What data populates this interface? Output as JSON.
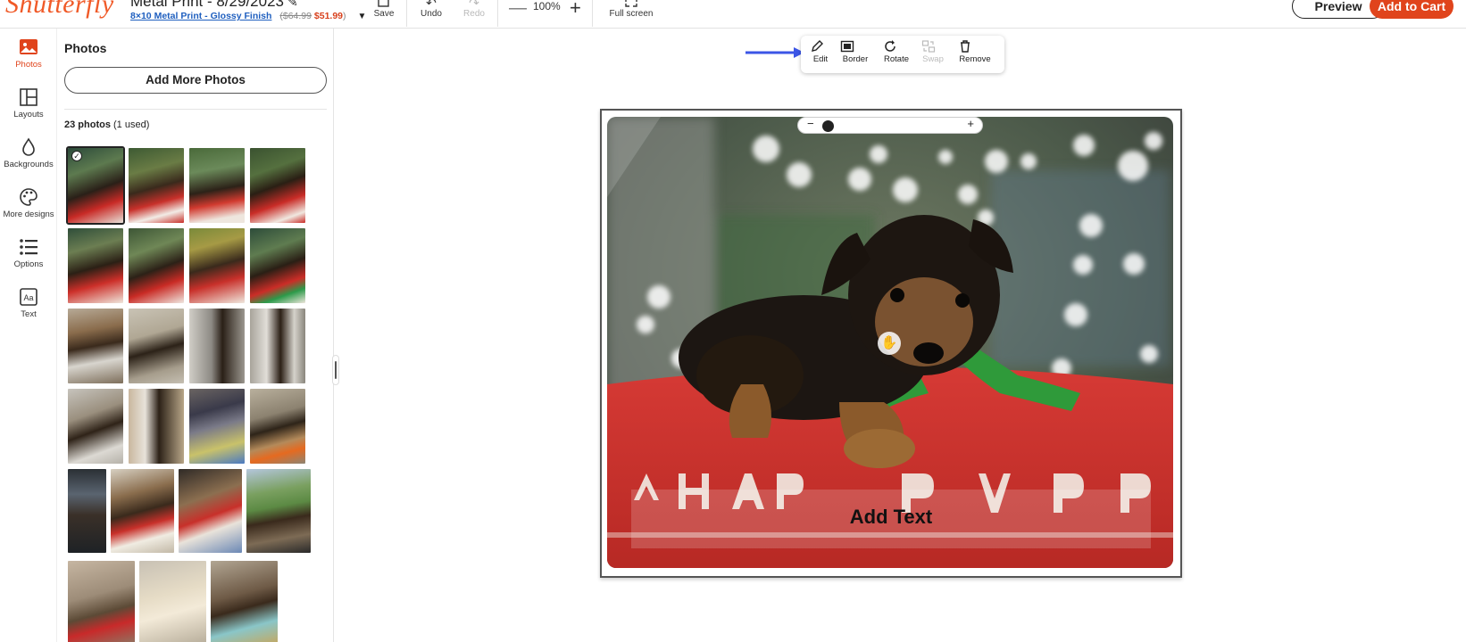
{
  "header": {
    "logo_text": "Shutterfly",
    "project_title": "Metal Print - 8/29/2023",
    "product_link": "8×10 Metal Print - Glossy Finish",
    "price_open": "(",
    "price_old": "$64.99",
    "price_new": "$51.99",
    "price_close": ")",
    "save_label": "Save",
    "undo_label": "Undo",
    "redo_label": "Redo",
    "zoom_value": "100%",
    "fullscreen_label": "Full screen",
    "preview_label": "Preview",
    "cart_label": "Add to Cart"
  },
  "rail": {
    "items": [
      {
        "label": "Photos",
        "icon": "photos-icon",
        "active": true
      },
      {
        "label": "Layouts",
        "icon": "layouts-icon"
      },
      {
        "label": "Backgrounds",
        "icon": "drop-icon"
      },
      {
        "label": "More designs",
        "icon": "palette-icon"
      },
      {
        "label": "Options",
        "icon": "list-icon"
      },
      {
        "label": "Text",
        "icon": "text-icon"
      }
    ]
  },
  "panel": {
    "title": "Photos",
    "add_more_label": "Add More Photos",
    "count_bold": "23 photos",
    "count_rest": " (1 used)"
  },
  "canvas": {
    "toolbar": {
      "edit": "Edit",
      "border": "Border",
      "rotate": "Rotate",
      "swap": "Swap",
      "remove": "Remove"
    },
    "add_text_label": "Add Text",
    "zoom_minus": "−",
    "zoom_plus": "+"
  },
  "colors": {
    "brand": "#f05a28",
    "cart": "#e0441c",
    "link": "#1f5fbf",
    "arrow": "#3b55e6"
  }
}
